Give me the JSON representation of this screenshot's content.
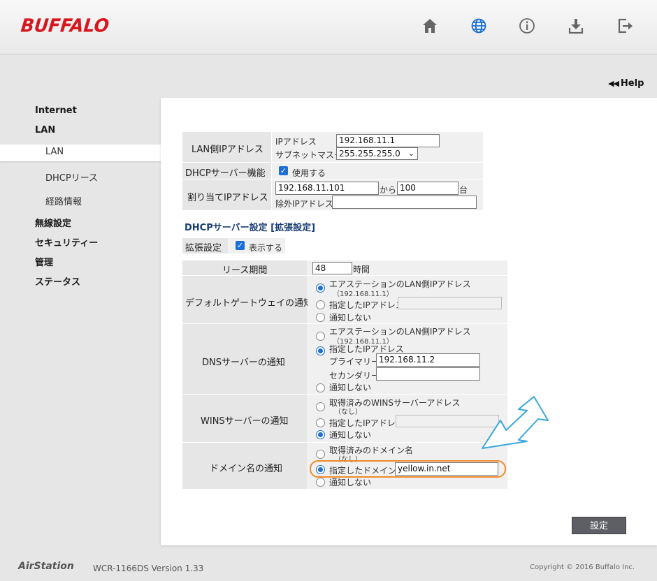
{
  "header": {
    "logo": "BUFFALO",
    "icons": [
      "home-icon",
      "globe-icon",
      "info-icon",
      "download-icon",
      "logout-icon"
    ]
  },
  "help": {
    "arrows": "◀◀",
    "label": "Help"
  },
  "sidebar": {
    "internet": "Internet",
    "lan": "LAN",
    "lan_sub": "LAN",
    "dhcp_lease": "DHCPリース",
    "route_info": "経路情報",
    "wireless": "無線設定",
    "security": "セキュリティー",
    "admin": "管理",
    "status": "ステータス"
  },
  "lan": {
    "lan_ip_label": "LAN側IPアドレス",
    "ip_label": "IPアドレス",
    "ip_value": "192.168.11.1",
    "subnet_label": "サブネットマスク",
    "subnet_value": "255.255.255.0",
    "dhcp_label": "DHCPサーバー機能",
    "dhcp_use": "使用する",
    "assign_label": "割り当てIPアドレス",
    "assign_start": "192.168.11.101",
    "from": "から",
    "count": "100",
    "unit": "台",
    "exclude_label": "除外IPアドレス:",
    "exclude_value": ""
  },
  "dhcp": {
    "title": "DHCPサーバー設定 [拡張設定]",
    "ext_label": "拡張設定",
    "show": "表示する",
    "lease_label": "リース期間",
    "lease_value": "48",
    "lease_unit": "時間",
    "gw_label": "デフォルトゲートウェイの通知",
    "gw_opt1": "エアステーションのLAN側IPアドレス",
    "gw_opt1_sub": "（192.168.11.1）",
    "gw_opt2": "指定したIPアドレス",
    "gw_opt3": "通知しない",
    "dns_label": "DNSサーバーの通知",
    "dns_opt1": "エアステーションのLAN側IPアドレス",
    "dns_opt1_sub": "（192.168.11.1）",
    "dns_opt2": "指定したIPアドレス",
    "primary_label": "プライマリー",
    "primary_value": "192.168.11.2",
    "secondary_label": "セカンダリー",
    "secondary_value": "",
    "dns_opt3": "通知しない",
    "wins_label": "WINSサーバーの通知",
    "wins_opt1": "取得済みのWINSサーバーアドレス",
    "wins_opt1_sub": "（なし）",
    "wins_opt2": "指定したIPアドレス",
    "wins_opt3": "通知しない",
    "domain_label": "ドメイン名の通知",
    "dom_opt1": "取得済みのドメイン名",
    "dom_opt1_sub": "（なし）",
    "dom_opt2": "指定したドメイン名",
    "domain_value": "yellow.in.net",
    "dom_opt3": "通知しない"
  },
  "buttons": {
    "submit": "設定"
  },
  "footer": {
    "brand": "AirStation",
    "model": "WCR-1166DS   Version 1.33",
    "copyright": "Copyright © 2016 Buffalo Inc."
  },
  "colors": {
    "accent": "#1c6fd6",
    "brand_red": "#d7171f",
    "highlight": "#f08a2a",
    "arrow": "#3aa7dc"
  }
}
